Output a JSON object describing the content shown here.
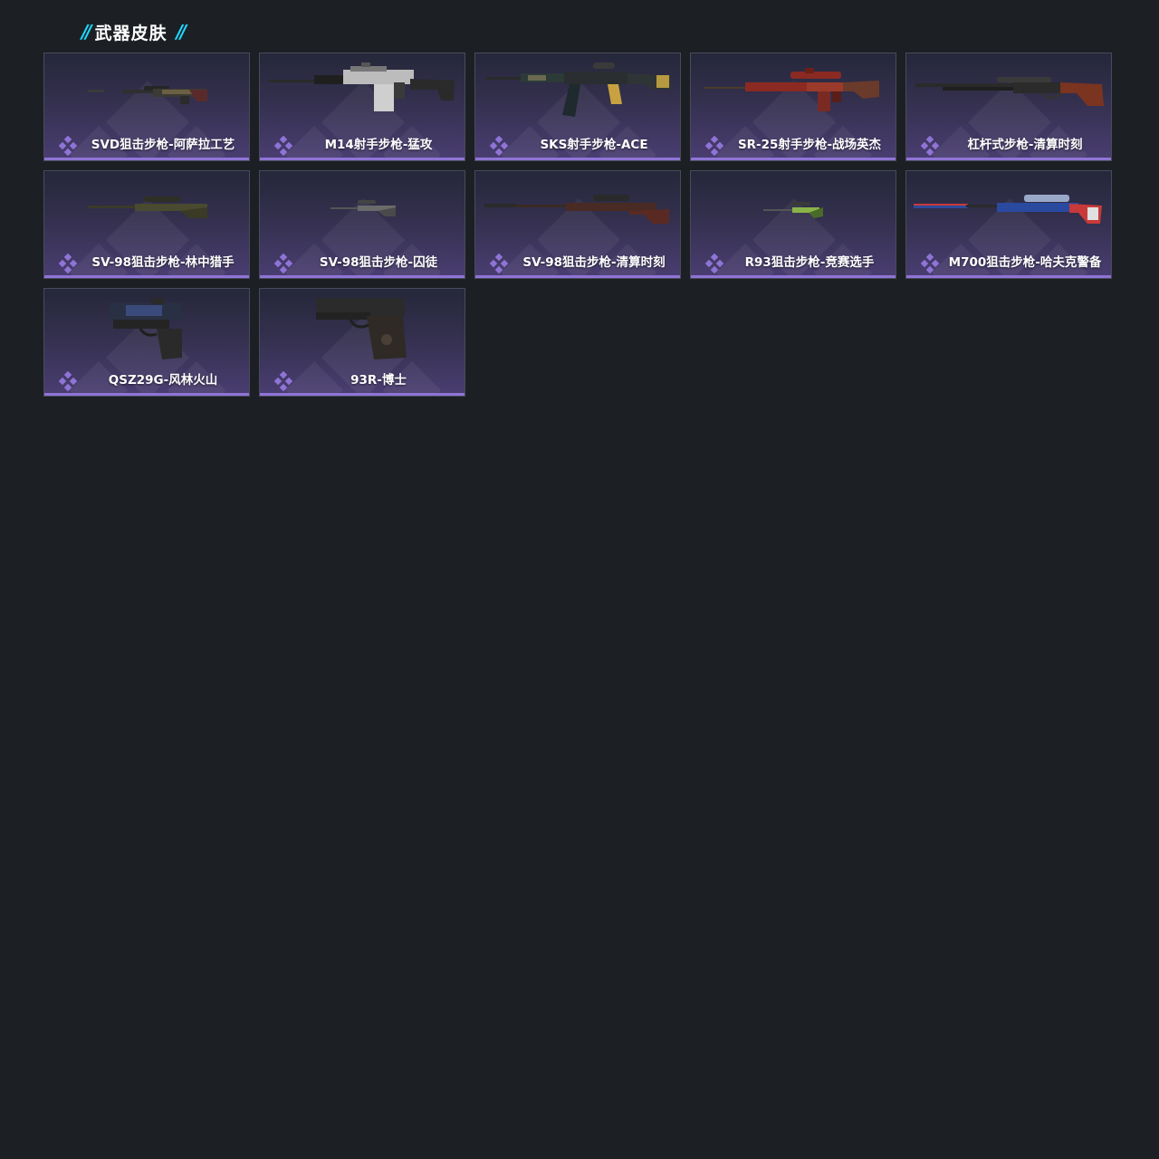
{
  "section": {
    "title": "武器皮肤",
    "slash_left": "//",
    "slash_right": "//"
  },
  "colors": {
    "background": "#1c2024",
    "accent_cyan": "#1fd6ff",
    "rarity_purple": "#8f74d6",
    "card_top": "#25273a",
    "card_bottom": "#4a3e72"
  },
  "skins": [
    {
      "label": "SVD狙击步枪-阿萨拉工艺",
      "icon": "sniper-rifle-icon",
      "rarity_icon": "rarity-diamond-icon"
    },
    {
      "label": "M14射手步枪-猛攻",
      "icon": "marksman-rifle-icon",
      "rarity_icon": "rarity-diamond-icon"
    },
    {
      "label": "SKS射手步枪-ACE",
      "icon": "marksman-rifle-icon",
      "rarity_icon": "rarity-diamond-icon"
    },
    {
      "label": "SR-25射手步枪-战场英杰",
      "icon": "marksman-rifle-icon",
      "rarity_icon": "rarity-diamond-icon"
    },
    {
      "label": "杠杆式步枪-清算时刻",
      "icon": "lever-action-rifle-icon",
      "rarity_icon": "rarity-diamond-icon"
    },
    {
      "label": "SV-98狙击步枪-林中猎手",
      "icon": "sniper-rifle-icon",
      "rarity_icon": "rarity-diamond-icon"
    },
    {
      "label": "SV-98狙击步枪-囚徒",
      "icon": "sniper-rifle-icon",
      "rarity_icon": "rarity-diamond-icon"
    },
    {
      "label": "SV-98狙击步枪-清算时刻",
      "icon": "sniper-rifle-icon",
      "rarity_icon": "rarity-diamond-icon"
    },
    {
      "label": "R93狙击步枪-竞赛选手",
      "icon": "sniper-rifle-icon",
      "rarity_icon": "rarity-diamond-icon"
    },
    {
      "label": "M700狙击步枪-哈夫克警备",
      "icon": "sniper-rifle-icon",
      "rarity_icon": "rarity-diamond-icon"
    },
    {
      "label": "QSZ29G-风林火山",
      "icon": "pistol-icon",
      "rarity_icon": "rarity-diamond-icon"
    },
    {
      "label": "93R-博士",
      "icon": "pistol-icon",
      "rarity_icon": "rarity-diamond-icon"
    }
  ]
}
